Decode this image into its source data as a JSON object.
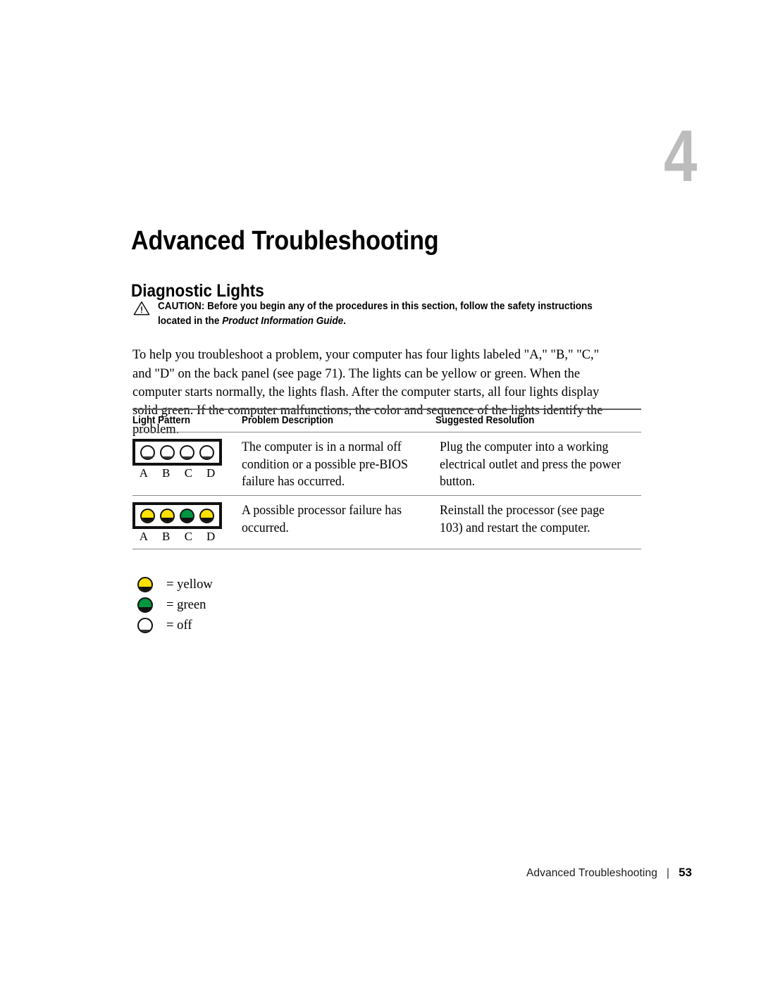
{
  "chapter": {
    "number": "4",
    "title": "Advanced Troubleshooting"
  },
  "section": {
    "title": "Diagnostic Lights"
  },
  "caution": {
    "icon": "warning-triangle-icon",
    "label": "CAUTION:",
    "text_before": " Before you begin any of the procedures in this section, follow the safety instructions located in the ",
    "guide_title": "Product Information Guide",
    "text_after": "."
  },
  "intro": {
    "paragraph": "To help you troubleshoot a problem, your computer has four lights labeled \"A,\" \"B,\" \"C,\" and \"D\" on the back panel (see page 71). The lights can be yellow or green. When the computer starts normally, the lights flash. After the computer starts, all four lights display solid green. If the computer malfunctions, the color and sequence of the lights identify the problem."
  },
  "table": {
    "headers": {
      "light_pattern": "Light Pattern",
      "problem_description": "Problem Description",
      "suggested_resolution": "Suggested Resolution"
    },
    "rows": [
      {
        "pattern": [
          "off",
          "off",
          "off",
          "off"
        ],
        "pattern_labels": [
          "A",
          "B",
          "C",
          "D"
        ],
        "problem": "The computer is in a normal off condition or a possible pre-BIOS failure has occurred.",
        "resolution": "Plug the computer into a working electrical outlet and press the power button."
      },
      {
        "pattern": [
          "yellow",
          "yellow",
          "green",
          "yellow"
        ],
        "pattern_labels": [
          "A",
          "B",
          "C",
          "D"
        ],
        "problem": "A possible processor failure has occurred.",
        "resolution": "Reinstall the processor (see page 103) and restart the computer."
      }
    ]
  },
  "legend": [
    {
      "state": "yellow",
      "label": "= yellow"
    },
    {
      "state": "green",
      "label": "= green"
    },
    {
      "state": "off",
      "label": "= off"
    }
  ],
  "footer": {
    "title": "Advanced Troubleshooting",
    "separator": "|",
    "page": "53"
  },
  "colors": {
    "yellow": "#ffe200",
    "green": "#009640",
    "off": "#ffffff",
    "chapter_number": "#bcbcbc",
    "rule_heavy": "#5f5f5f",
    "rule_thin": "#8a8a8a"
  }
}
